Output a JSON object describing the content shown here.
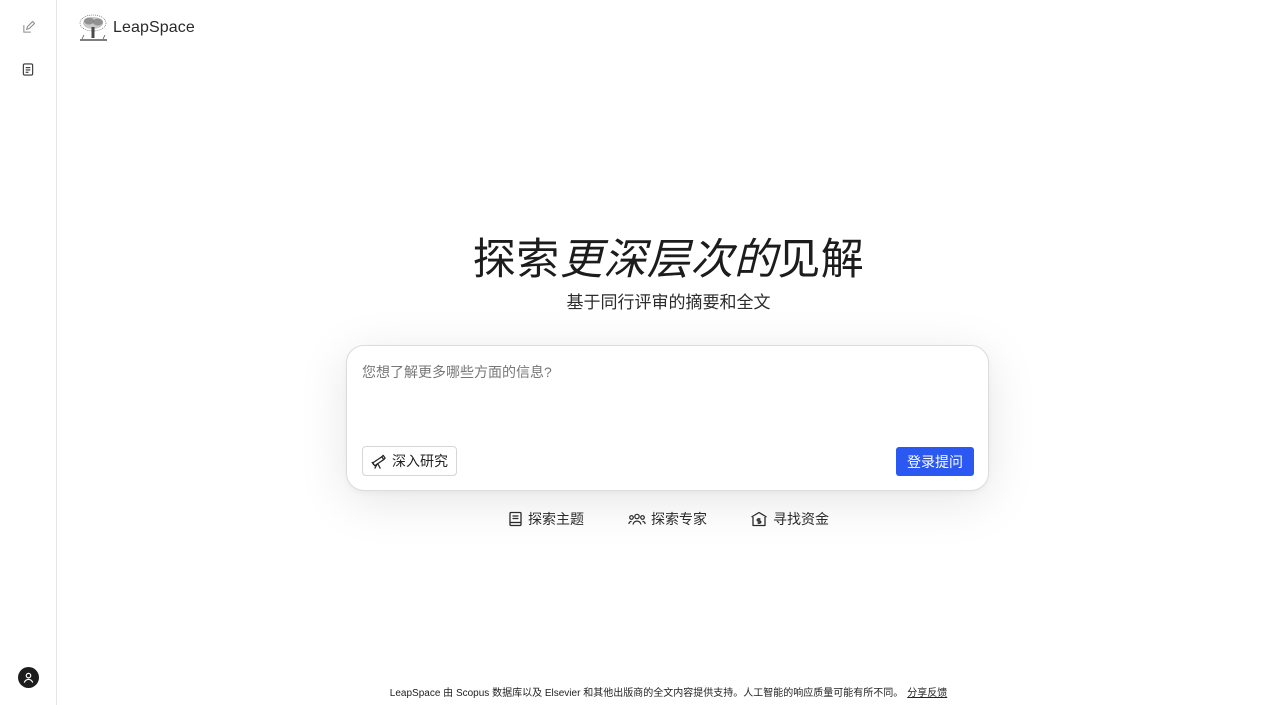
{
  "sidebar": {
    "new_chat_icon": "edit-icon",
    "history_icon": "document-icon",
    "account_icon": "user-icon"
  },
  "brand": {
    "name": "LeapSpace",
    "logo_icon": "elsevier-tree-logo"
  },
  "hero": {
    "title_part1": "探索",
    "title_emphasis": "更深层次的",
    "title_part2": "见解",
    "subtitle": "基于同行评审的摘要和全文"
  },
  "search": {
    "placeholder": "您想了解更多哪些方面的信息?",
    "value": "",
    "deep_research_label": "深入研究",
    "deep_research_icon": "telescope-icon",
    "submit_label": "登录提问",
    "submit_color": "#2b58f0"
  },
  "quick_links": [
    {
      "label": "探索主题",
      "icon": "book-icon"
    },
    {
      "label": "探索专家",
      "icon": "people-icon"
    },
    {
      "label": "寻找资金",
      "icon": "funding-icon"
    }
  ],
  "footer": {
    "text": "LeapSpace 由 Scopus 数据库以及 Elsevier 和其他出版商的全文内容提供支持。人工智能的响应质量可能有所不同。",
    "link": "分享反馈"
  }
}
